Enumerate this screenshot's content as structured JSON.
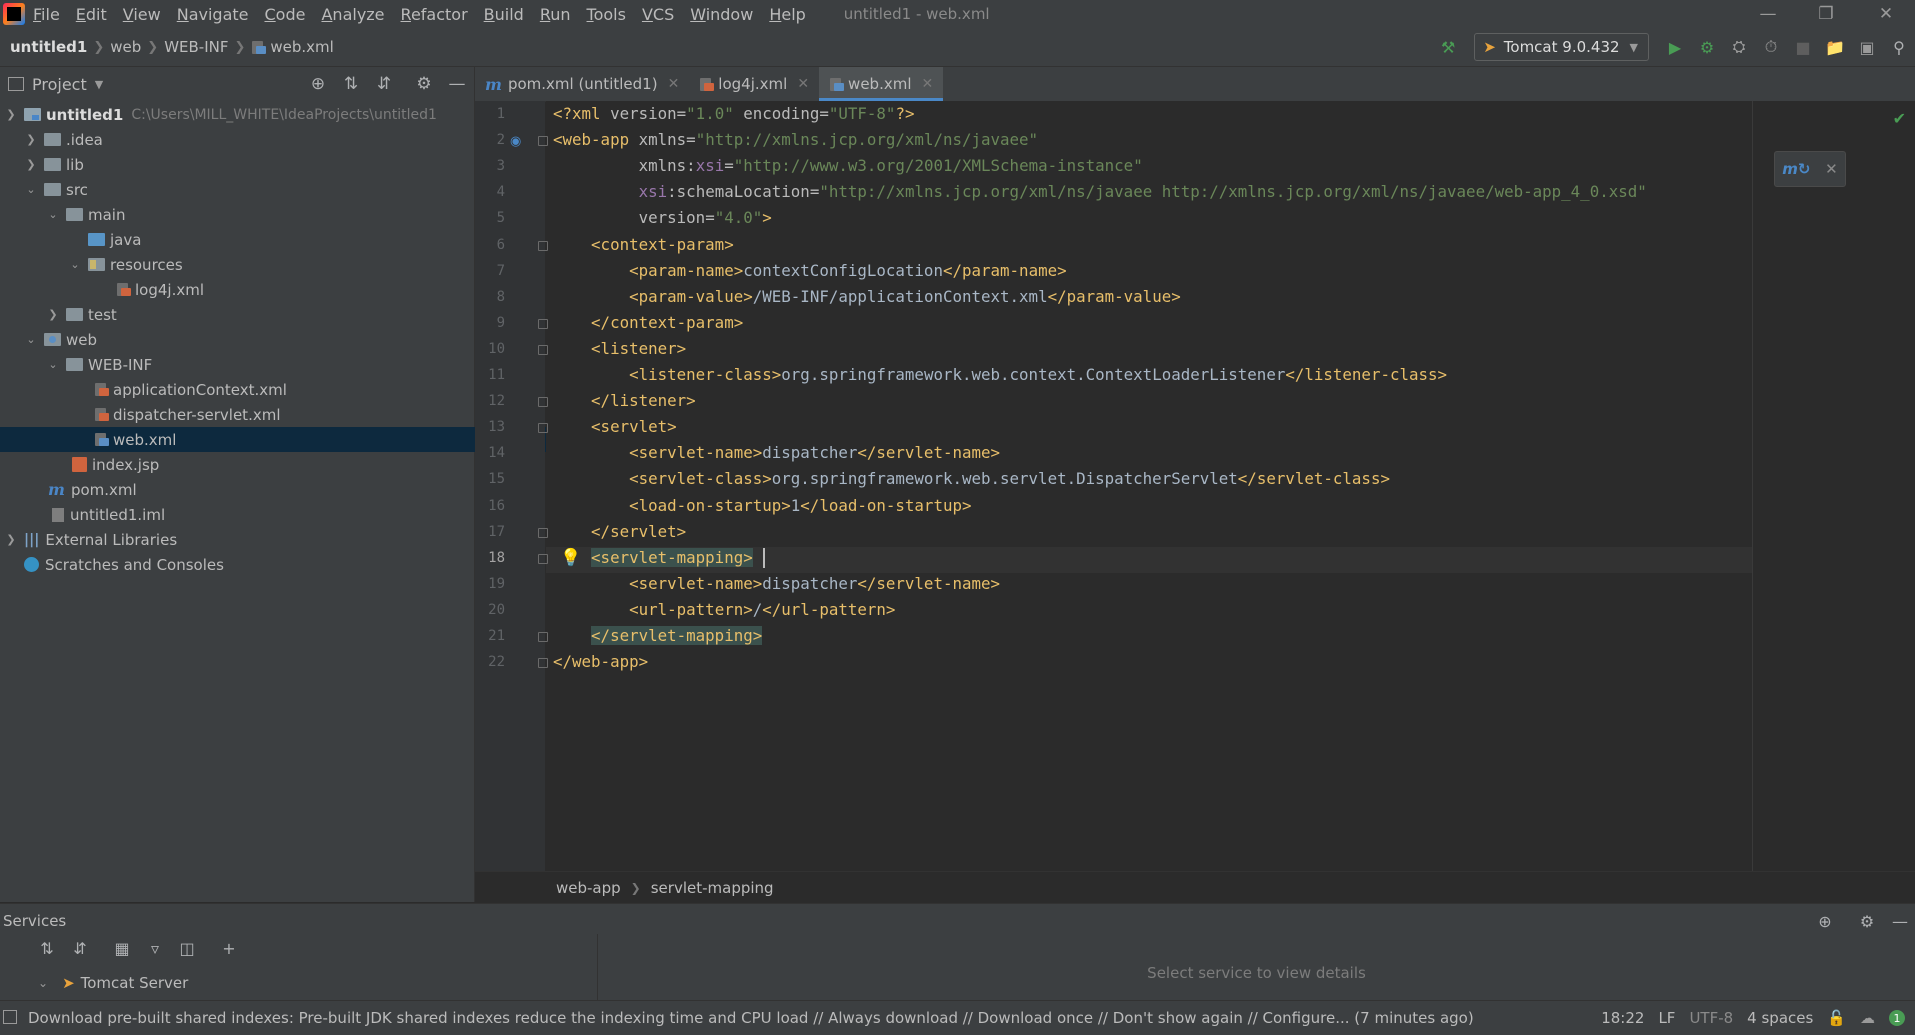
{
  "menu": [
    "File",
    "Edit",
    "View",
    "Navigate",
    "Code",
    "Analyze",
    "Refactor",
    "Build",
    "Run",
    "Tools",
    "VCS",
    "Window",
    "Help"
  ],
  "window_title": "untitled1 - web.xml",
  "nav": {
    "crumbs": [
      "untitled1",
      "web",
      "WEB-INF",
      "web.xml"
    ]
  },
  "run_config": {
    "label": "Tomcat 9.0.432"
  },
  "project": {
    "title": "Project",
    "root_name": "untitled1",
    "root_path": "C:\\Users\\MILL_WHITE\\IdeaProjects\\untitled1",
    "items": [
      ".idea",
      "lib",
      "src",
      "main",
      "java",
      "resources",
      "log4j.xml",
      "test",
      "web",
      "WEB-INF",
      "applicationContext.xml",
      "dispatcher-servlet.xml",
      "web.xml",
      "index.jsp",
      "pom.xml",
      "untitled1.iml",
      "External Libraries",
      "Scratches and Consoles"
    ]
  },
  "tabs": [
    {
      "label": "pom.xml (untitled1)"
    },
    {
      "label": "log4j.xml"
    },
    {
      "label": "web.xml"
    }
  ],
  "editor": {
    "current_line": 18,
    "line_numbers": [
      "1",
      "2",
      "3",
      "4",
      "5",
      "6",
      "7",
      "8",
      "9",
      "10",
      "11",
      "12",
      "13",
      "14",
      "15",
      "16",
      "17",
      "18",
      "19",
      "20",
      "21",
      "22"
    ],
    "lines": [
      "<?xml version=\"1.0\" encoding=\"UTF-8\"?>",
      "<web-app xmlns=\"http://xmlns.jcp.org/xml/ns/javaee\"",
      "         xmlns:xsi=\"http://www.w3.org/2001/XMLSchema-instance\"",
      "         xsi:schemaLocation=\"http://xmlns.jcp.org/xml/ns/javaee http://xmlns.jcp.org/xml/ns/javaee/web-app_4_0.xsd\"",
      "         version=\"4.0\">",
      "    <context-param>",
      "        <param-name>contextConfigLocation</param-name>",
      "        <param-value>/WEB-INF/applicationContext.xml</param-value>",
      "    </context-param>",
      "    <listener>",
      "        <listener-class>org.springframework.web.context.ContextLoaderListener</listener-class>",
      "    </listener>",
      "    <servlet>",
      "        <servlet-name>dispatcher</servlet-name>",
      "        <servlet-class>org.springframework.web.servlet.DispatcherServlet</servlet-class>",
      "        <load-on-startup>1</load-on-startup>",
      "    </servlet>",
      "    <servlet-mapping>",
      "        <servlet-name>dispatcher</servlet-name>",
      "        <url-pattern>/</url-pattern>",
      "    </servlet-mapping>",
      "</web-app>"
    ]
  },
  "breadcrumb": [
    "web-app",
    "servlet-mapping"
  ],
  "services": {
    "title": "Services",
    "tree_item": "Tomcat Server",
    "detail_placeholder": "Select service to view details"
  },
  "status": {
    "message": "Download pre-built shared indexes: Pre-built JDK shared indexes reduce the indexing time and CPU load // Always download // Download once // Don't show again // Configure... (7 minutes ago)",
    "position": "18:22",
    "line_sep": "LF",
    "encoding": "UTF-8",
    "indent": "4 spaces",
    "notifications": "1"
  },
  "colors": {
    "tag": "#e8bf6a",
    "attr_value": "#6a8759",
    "namespace": "#9876aa",
    "text": "#a9b7c6",
    "selection": "#0d293e",
    "run_green": "#499c54"
  },
  "icons": [
    "app-logo",
    "project-tool-icon",
    "locate-icon",
    "expand-all-icon",
    "collapse-all-icon",
    "gear-icon",
    "hide-icon",
    "build-hammer-icon",
    "run-icon",
    "debug-icon",
    "coverage-icon",
    "profile-icon",
    "stop-icon",
    "project-structure-icon",
    "search-icon",
    "lightbulb-icon",
    "checkmark-icon",
    "maven-reload-icon"
  ]
}
